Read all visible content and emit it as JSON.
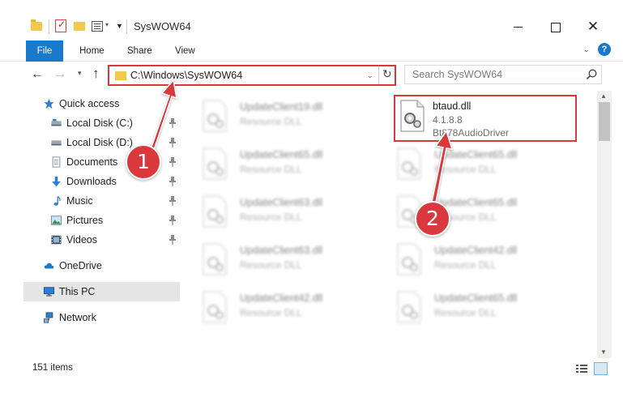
{
  "window": {
    "title": "SysWOW64",
    "minimize_glyph": "",
    "maximize_glyph": "",
    "close_glyph": "✕"
  },
  "ribbon": {
    "tabs": [
      {
        "label": "File",
        "active": true
      },
      {
        "label": "Home"
      },
      {
        "label": "Share"
      },
      {
        "label": "View"
      }
    ],
    "help_glyph": "?"
  },
  "address": {
    "path": "C:\\Windows\\SysWOW64",
    "search_placeholder": "Search SysWOW64"
  },
  "nav": {
    "items": [
      {
        "label": "Quick access",
        "icon": "star-icon",
        "pinned": false
      },
      {
        "label": "Local Disk (C:)",
        "icon": "drive-icon",
        "pinned": true
      },
      {
        "label": "Local Disk (D:)",
        "icon": "drive-icon",
        "pinned": true
      },
      {
        "label": "Documents",
        "icon": "documents-icon",
        "pinned": true
      },
      {
        "label": "Downloads",
        "icon": "download-icon",
        "pinned": true
      },
      {
        "label": "Music",
        "icon": "music-icon",
        "pinned": true
      },
      {
        "label": "Pictures",
        "icon": "pictures-icon",
        "pinned": true
      },
      {
        "label": "Videos",
        "icon": "videos-icon",
        "pinned": true
      },
      {
        "label": "OneDrive",
        "icon": "cloud-icon"
      },
      {
        "label": "This PC",
        "icon": "computer-icon"
      },
      {
        "label": "Network",
        "icon": "network-icon"
      }
    ]
  },
  "files": {
    "left_column": [
      {
        "name": "UpdateClient19.dll",
        "type": "Resource DLL"
      },
      {
        "name": "UpdateClient65.dll",
        "type": "Resource DLL"
      },
      {
        "name": "UpdateClient63.dll",
        "type": "Resource DLL"
      },
      {
        "name": "UpdateClient63.dll",
        "type": "Resource DLL"
      },
      {
        "name": "UpdateClient42.dll",
        "type": "Resource DLL"
      }
    ],
    "right_column": [
      {
        "name": "UpdateClient65.dll",
        "type": "Resource DLL"
      },
      {
        "name": "UpdateClient65.dll",
        "type": "Resource DLL"
      },
      {
        "name": "UpdateClient42.dll",
        "type": "Resource DLL"
      },
      {
        "name": "UpdateClient65.dll",
        "type": "Resource DLL"
      }
    ],
    "highlighted": {
      "name": "btaud.dll",
      "version": "4.1.8.8",
      "description": "Bt878AudioDriver"
    }
  },
  "status": {
    "item_count": "151 items"
  },
  "callouts": {
    "one": "1",
    "two": "2"
  },
  "colors": {
    "accent": "#1979ca",
    "callout": "#d9393d",
    "selection": "#cce4f7"
  }
}
